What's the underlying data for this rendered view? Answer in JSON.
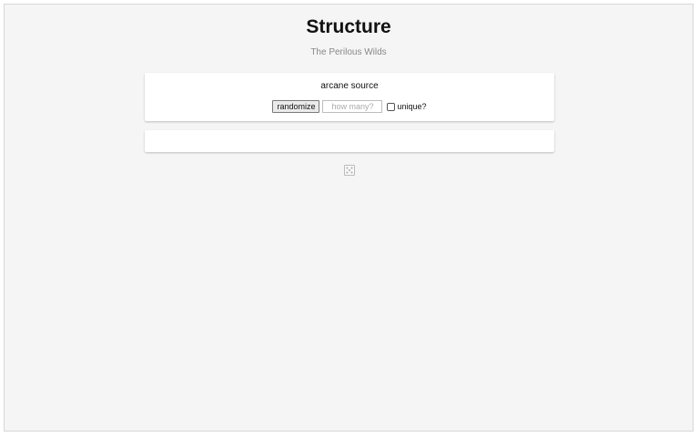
{
  "page": {
    "title": "Structure",
    "subtitle": "The Perilous Wilds"
  },
  "generator": {
    "title": "arcane source",
    "randomize_label": "randomize",
    "count_placeholder": "how many?",
    "count_value": "",
    "unique_label": "unique?",
    "unique_checked": false
  },
  "results": {
    "items": []
  },
  "icons": {
    "dice": "dice-icon"
  }
}
